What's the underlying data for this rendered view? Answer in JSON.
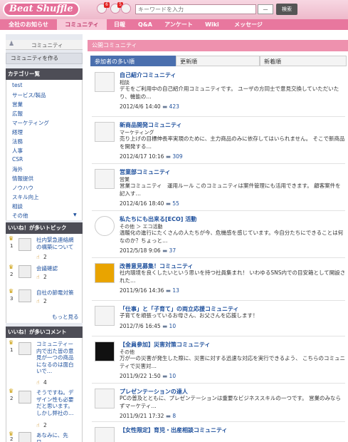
{
  "app": {
    "logo": "Beat Shuffle",
    "badge1": "6",
    "badge2": "5"
  },
  "search": {
    "placeholder": "キーワードを入力",
    "select_value": "—",
    "button": "検索"
  },
  "nav": [
    {
      "label": "全社のお知らせ"
    },
    {
      "label": "コミュニティ"
    },
    {
      "label": "日報"
    },
    {
      "label": "Q&A"
    },
    {
      "label": "アンケート"
    },
    {
      "label": "Wiki"
    },
    {
      "label": "メッセージ"
    }
  ],
  "sidebar": {
    "title": "コミュニティ",
    "create_label": "コミュニティを作る",
    "category_heading": "カテゴリー覧",
    "categories": [
      "test",
      "サービス/製品",
      "営業",
      "広報",
      "マーケティング",
      "経理",
      "法務",
      "人事",
      "CSR",
      "海外",
      "情報提供",
      "ノウハウ",
      "スキル向上",
      "相談",
      "その他"
    ],
    "topics_heading": "いいね！が多いトピック",
    "topics": [
      {
        "rank": "1",
        "text": "社内緊急連絡網の構築について",
        "likes": "2"
      },
      {
        "rank": "2",
        "text": "会議確認",
        "likes": "2"
      },
      {
        "rank": "3",
        "text": "自社の節電対策",
        "likes": "2"
      }
    ],
    "more_label": "もっと見る",
    "comments_heading": "いいね！が多いコメント",
    "comments": [
      {
        "rank": "1",
        "text": "コミュニティー内で出た皆の意見が一つの商品になるのは面白いで…",
        "likes": "4"
      },
      {
        "rank": "2",
        "text": "そうですね。デザイン性も必要だと思います。しかし弊社の…",
        "likes": "2"
      },
      {
        "rank": "2",
        "text": "あなみに、先日…",
        "likes": ""
      }
    ]
  },
  "main": {
    "header": "公開コミュニティ",
    "tabs": [
      {
        "label": "参加者の多い順"
      },
      {
        "label": "更新順"
      },
      {
        "label": "新着順"
      }
    ],
    "entries": [
      {
        "title": "自己紹介コミュニティ",
        "category": "相談",
        "desc": "デモをご利用中の自己紹介用コミュニティです。 ユーザの方同士で意見交換していただいたり、機能の…",
        "date": "2012/4/6 14:40",
        "count": "423"
      },
      {
        "title": "新商品開発コミュニティ",
        "category": "マーケティング",
        "desc": "売り上げの目標伸長率実現のために、主力商品のみに依存してはいられません。 そこで新商品を開発する…",
        "date": "2012/4/17 10:16",
        "count": "309"
      },
      {
        "title": "営業部コミュニティ",
        "category": "営業",
        "desc": "営業コミュニティ　運用ルール このコミュニティは案件管理にも活用できます。 顧客案件を記入す…",
        "date": "2012/4/16 18:40",
        "count": "55"
      },
      {
        "title": "私たちにも出来る[ECO] 活動",
        "category": "その他 ＞ エコ活動",
        "desc": "温暖化の進行にたくさんの人たちが今、危機感を感じています。今自分たちにできることは何なのか？ちょっと…",
        "date": "2012/5/18 9:06",
        "count": "37"
      },
      {
        "title": "改善意見募集！コミュニティ",
        "category": "",
        "desc": "社内環境を良くしたいという思いを持つ社員集まれ！ いわゆるSNS内での目安箱として開設された…",
        "date": "2011/9/16 14:36",
        "count": "13"
      },
      {
        "title": "「仕事」と「子育て」の両立応援コミュニティ",
        "category": "",
        "desc": "子育てを頑張っているお母さん、お父さんを応援します！",
        "date": "2012/7/6 16:45",
        "count": "10"
      },
      {
        "title": "【全員参加】災害対策コミュニティ",
        "category": "その他",
        "desc": "万が一の災害が発生した際に、災害に対する迅速な対応を実行できるよう、 こちらのコミュニティで災害対…",
        "date": "2011/9/22 1:50",
        "count": "10"
      },
      {
        "title": "プレゼンテーションの達人",
        "category": "",
        "desc": "PCの普及とともに、プレゼンテーションは重要なビジネススキルの一つです。 営業のみならずマーケティ…",
        "date": "2011/9/21 17:32",
        "count": "8"
      },
      {
        "title": "【女性限定】育児・出産相談コミュニティ",
        "category": "",
        "desc": "",
        "date": "",
        "count": ""
      }
    ]
  },
  "colors": {
    "nav_bg": "#e8779e",
    "header_bg": "#ee91ae",
    "tab_active": "#4a6fae",
    "link": "#1d4f9c"
  }
}
